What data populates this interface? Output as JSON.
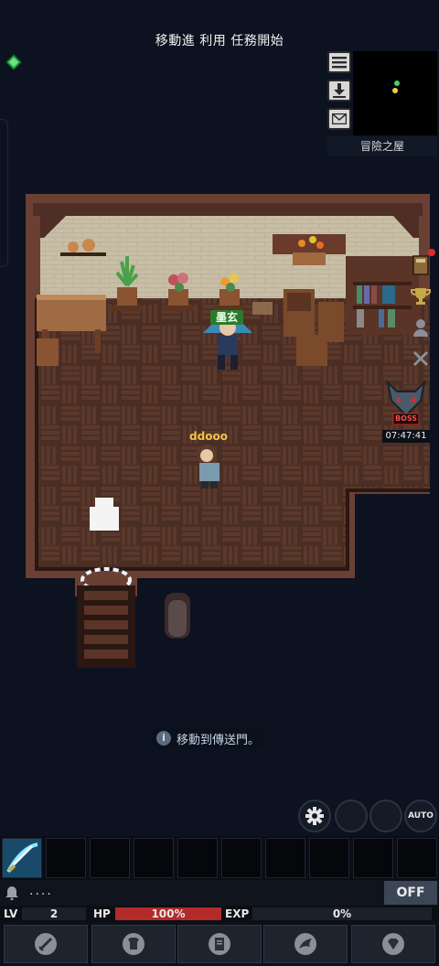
{
  "quest": {
    "text": "移動進 利用 任務開始"
  },
  "minimap": {
    "label": "冒險之屋"
  },
  "npc": {
    "name": "墨玄"
  },
  "player": {
    "name": "ddooo"
  },
  "boss": {
    "label": "BOSS",
    "timer": "07:47:41"
  },
  "hint": {
    "icon": "i",
    "text": "移動到傳送門。"
  },
  "controls": {
    "auto_label": "AUTO"
  },
  "chat": {
    "dots": "....",
    "toggle": "OFF"
  },
  "stats": {
    "lv_label": "LV",
    "lv": "2",
    "hp_label": "HP",
    "hp": "100%",
    "exp_label": "EXP",
    "exp": "0%",
    "hp_fraction": 1.0,
    "exp_fraction": 0.0
  },
  "menu": {
    "items": [
      "sword-icon",
      "armor-icon",
      "scroll-icon",
      "wing-icon",
      "gem-icon"
    ]
  },
  "colors": {
    "hp": "#b22a2a",
    "npc_tag": "#2d7a2d",
    "player_name": "#f2c24a"
  }
}
